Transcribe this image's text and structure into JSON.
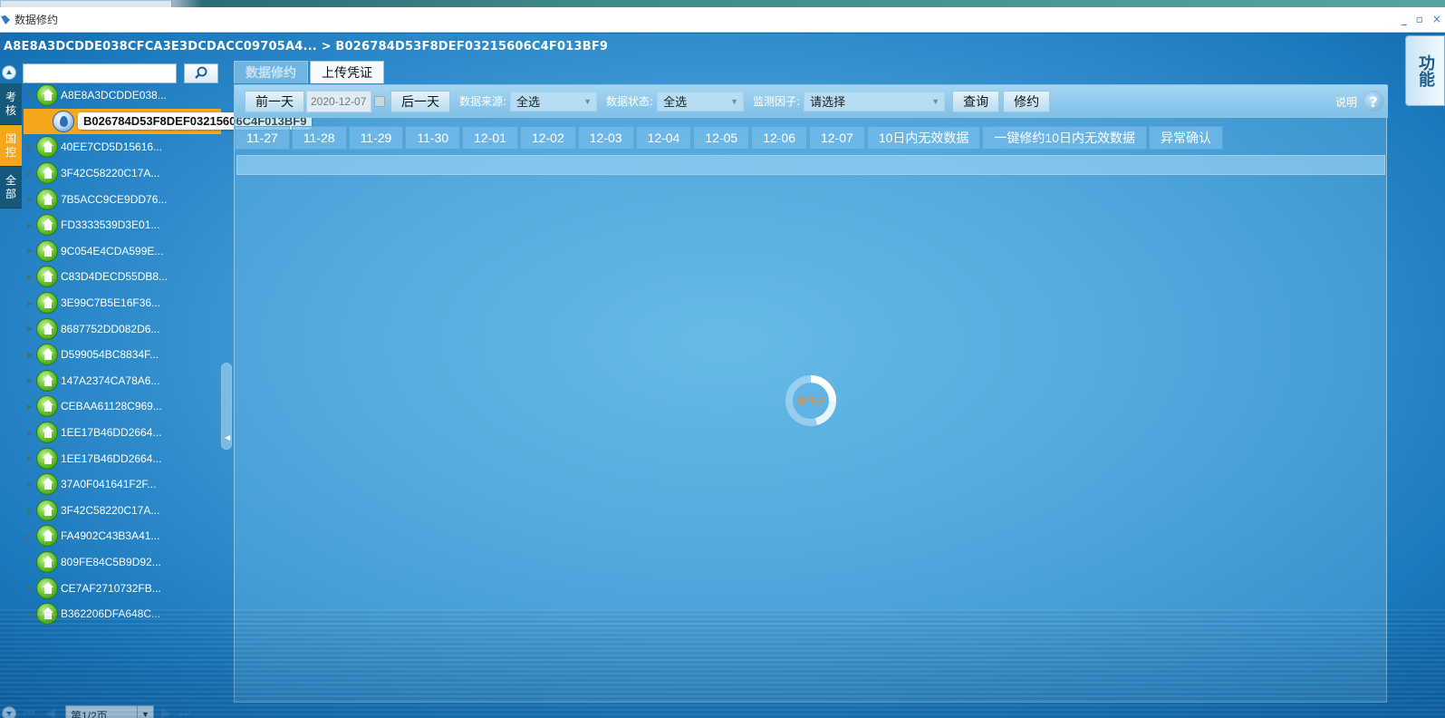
{
  "window": {
    "title": "数据修约",
    "controls": [
      "_",
      "▫",
      "×"
    ]
  },
  "breadcrumb": "A8E8A3DCDDE038CFCA3E3DCDACC09705A4... > B026784D53F8DEF03215606C4F013BF9",
  "vtabs": [
    {
      "label": "考核",
      "active": false
    },
    {
      "label": "国控",
      "active": true
    },
    {
      "label": "全部",
      "active": false
    }
  ],
  "search": {
    "placeholder": "",
    "value": ""
  },
  "tree": {
    "root": "A8E8A3DCDDE038...",
    "selected": "B026784D53F8DEF03215606C4F013BF9",
    "items": [
      "40EE7CD5D15616...",
      "3F42C58220C17A...",
      "7B5ACC9CE9DD76...",
      "FD3333539D3E01...",
      "9C054E4CDA599E...",
      "C83D4DECD55DB8...",
      "3E99C7B5E16F36...",
      "8687752DD082D6...",
      "D599054BC8834F...",
      "147A2374CA78A6...",
      "CEBAA61128C969...",
      "1EE17B46DD2664...",
      "1EE17B46DD2664...",
      "37A0F041641F2F...",
      "3F42C58220C17A...",
      "FA4902C43B3A41...",
      "809FE84C5B9D92...",
      "CE7AF2710732FB...",
      "B362206DFA648C..."
    ]
  },
  "pager": {
    "page_label": "第1/2页"
  },
  "tabs": [
    {
      "label": "数据修约",
      "active": true
    },
    {
      "label": "上传凭证",
      "active": false
    }
  ],
  "toolbar": {
    "prev_day": "前一天",
    "date": "2020-12-07",
    "next_day": "后一天",
    "source_label": "数据来源:",
    "source_value": "全选",
    "status_label": "数据状态:",
    "status_value": "全选",
    "factor_label": "监测因子:",
    "factor_value": "请选择",
    "query": "查询",
    "revise": "修约",
    "help_label": "说明",
    "help_icon": "?"
  },
  "date_tabs": [
    "11-27",
    "11-28",
    "11-29",
    "11-30",
    "12-01",
    "12-02",
    "12-03",
    "12-04",
    "12-05",
    "12-06",
    "12-07",
    "10日内无效数据",
    "一键修约10日内无效数据",
    "异常确认"
  ],
  "loading_text": "加载中",
  "side_panel": {
    "label": "功能"
  },
  "colors": {
    "accent": "#f7a51a",
    "tree_icon": "#5fc02a",
    "loader": "#f58a20"
  }
}
